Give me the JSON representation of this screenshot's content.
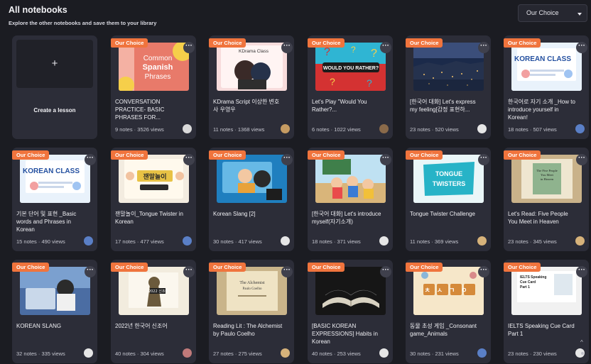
{
  "header": {
    "title": "All notebooks",
    "subtitle": "Explore the other notebooks and save them to your library",
    "sort_value": "Our Choice"
  },
  "create": {
    "plus": "+",
    "label": "Create a lesson"
  },
  "badge_label": "Our Choice",
  "more_label": "···",
  "colors": {
    "background": "#1b1c22",
    "card": "#2c2d38",
    "badge": "#f0743d"
  },
  "notebooks": [
    {
      "title": "CONVERSATION PRACTICE- BASIC PHRASES FOR...",
      "meta": "9 notes · 3526 views",
      "thumb": "Common Spanish Phrases",
      "thumb_style": "spanish",
      "avatar": "#d9d9d9"
    },
    {
      "title": "KDrama Script 이상한 변호사 우영우",
      "meta": "11 notes · 1368 views",
      "thumb": "KDrama Class",
      "thumb_style": "kdrama",
      "avatar": "#c59b62"
    },
    {
      "title": "Let's Play \"Would You Rather?...",
      "meta": "6 notes · 1022 views",
      "thumb": "WOULD YOU RATHER?",
      "thumb_style": "wyr",
      "avatar": "#8a6a4a"
    },
    {
      "title": "[한국어 대화] Let's express my feeling[감정 표현하...",
      "meta": "23 notes · 520 views",
      "thumb": "",
      "thumb_style": "city",
      "avatar": "#e6e6e6"
    },
    {
      "title": "한국어로 자기 소개 _How to introduce yourself in Korean!",
      "meta": "18 notes · 507 views",
      "thumb": "KOREAN CLASS",
      "thumb_style": "kclass",
      "avatar": "#5a7fc6"
    },
    {
      "title": "기본 단어 및 표현 _Basic words and Phrases in Korean",
      "meta": "15 notes · 490 views",
      "thumb": "KOREAN CLASS",
      "thumb_style": "kclass",
      "avatar": "#5a7fc6"
    },
    {
      "title": "잰말놀이_Tongue Twister in Korean",
      "meta": "17 notes · 477 views",
      "thumb": "잰말놀이",
      "thumb_style": "twister_kr",
      "avatar": "#5a7fc6"
    },
    {
      "title": "Korean Slang [2]",
      "meta": "30 notes · 417 views",
      "thumb": "",
      "thumb_style": "slang2",
      "avatar": "#e6e6e6"
    },
    {
      "title": "[한국어 대화] Let's introduce myself(자기소개)",
      "meta": "18 notes · 371 views",
      "thumb": "",
      "thumb_style": "classroom",
      "avatar": "#e6e6e6"
    },
    {
      "title": "Tongue Twister Challenge",
      "meta": "11 notes · 369 views",
      "thumb": "TONGUE TWISTERS",
      "thumb_style": "twister_en",
      "avatar": "#d6b27a"
    },
    {
      "title": "Let's Read: Five People You Meet in Heaven",
      "meta": "23 notes · 345 views",
      "thumb": "The Five People You Meet in Heaven",
      "thumb_style": "book",
      "avatar": "#d6b27a"
    },
    {
      "title": "KOREAN SLANG",
      "meta": "32 notes · 335 views",
      "thumb": "",
      "thumb_style": "slang",
      "avatar": "#e6e6e6"
    },
    {
      "title": "2022년 한국어 신조어",
      "meta": "40 notes · 304 views",
      "thumb": "2022 신조어",
      "thumb_style": "sinjoeo",
      "avatar": "#c07a7a"
    },
    {
      "title": "Reading Lit : The Alchemist by Paulo Coelho",
      "meta": "27 notes · 275 views",
      "thumb": "The Alchemist Paulo Coelho",
      "thumb_style": "alchemist",
      "avatar": "#d6b27a"
    },
    {
      "title": "[BASIC KOREAN EXPRESSIONS] Habits in Korean",
      "meta": "40 notes · 253 views",
      "thumb": "",
      "thumb_style": "openbook",
      "avatar": "#e6e6e6"
    },
    {
      "title": "동물 초성 게임 _Consonant game_Animals",
      "meta": "30 notes · 231 views",
      "thumb": "ㅊㅅㄱㅇ",
      "thumb_style": "consonant",
      "avatar": "#5a7fc6"
    },
    {
      "title": "IELTS Speaking Cue Card Part 1",
      "meta": "23 notes · 230 views",
      "thumb": "IELTS Speaking Cue Card Part 1",
      "thumb_style": "ielts",
      "avatar": "#e6e6e6"
    }
  ],
  "scroll_up": "^"
}
